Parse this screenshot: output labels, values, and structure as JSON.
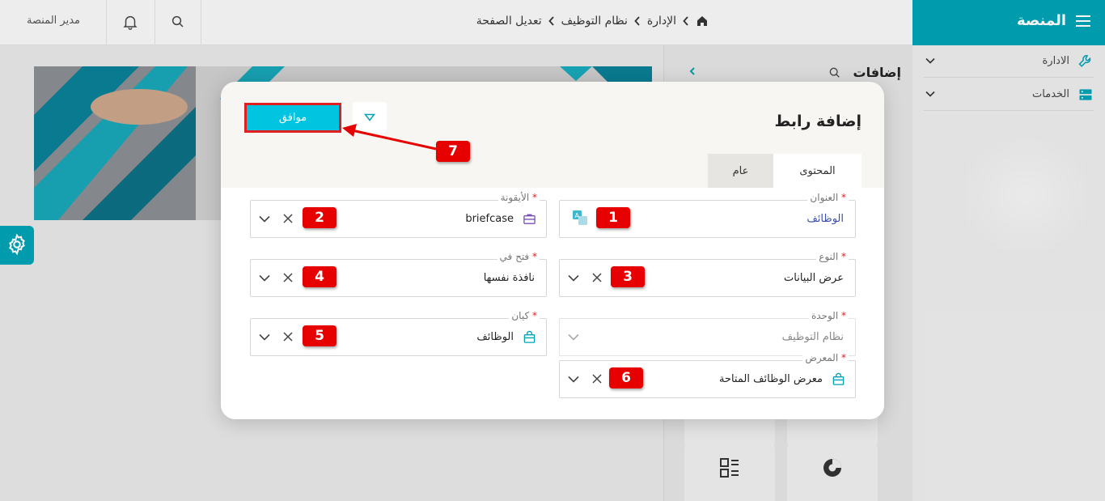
{
  "header": {
    "user_name": "مدير المنصة",
    "breadcrumb": [
      "الإدارة",
      "نظام التوظيف",
      "تعديل الصفحة"
    ]
  },
  "brand": {
    "title": "المنصة",
    "color": "#00a2b5"
  },
  "sidebar": {
    "items": [
      {
        "label": "الادارة",
        "icon": "wrench-icon"
      },
      {
        "label": "الخدمات",
        "icon": "server-icon"
      }
    ]
  },
  "panel": {
    "title": "إضافات"
  },
  "dialog": {
    "title": "إضافة رابط",
    "ok_label": "موافق",
    "tabs": [
      {
        "label": "المحتوى",
        "active": true
      },
      {
        "label": "عام",
        "active": false
      }
    ],
    "fields": {
      "title": {
        "label": "العنوان",
        "value": "الوظائف"
      },
      "icon": {
        "label": "الأيقونة",
        "value": "briefcase"
      },
      "type": {
        "label": "النوع",
        "value": "عرض البيانات"
      },
      "open_in": {
        "label": "فتح في",
        "value": "نافذة نفسها"
      },
      "unit": {
        "label": "الوحدة",
        "value": "نظام التوظيف"
      },
      "entity": {
        "label": "كيان",
        "value": "الوظائف"
      },
      "gallery": {
        "label": "المعرض",
        "value": "معرض الوظائف المتاحة"
      }
    },
    "required_mark": "*"
  },
  "annotations": [
    "1",
    "2",
    "3",
    "4",
    "5",
    "6",
    "7"
  ],
  "colors": {
    "accent": "#00c4e0",
    "annotation": "#e60000"
  }
}
